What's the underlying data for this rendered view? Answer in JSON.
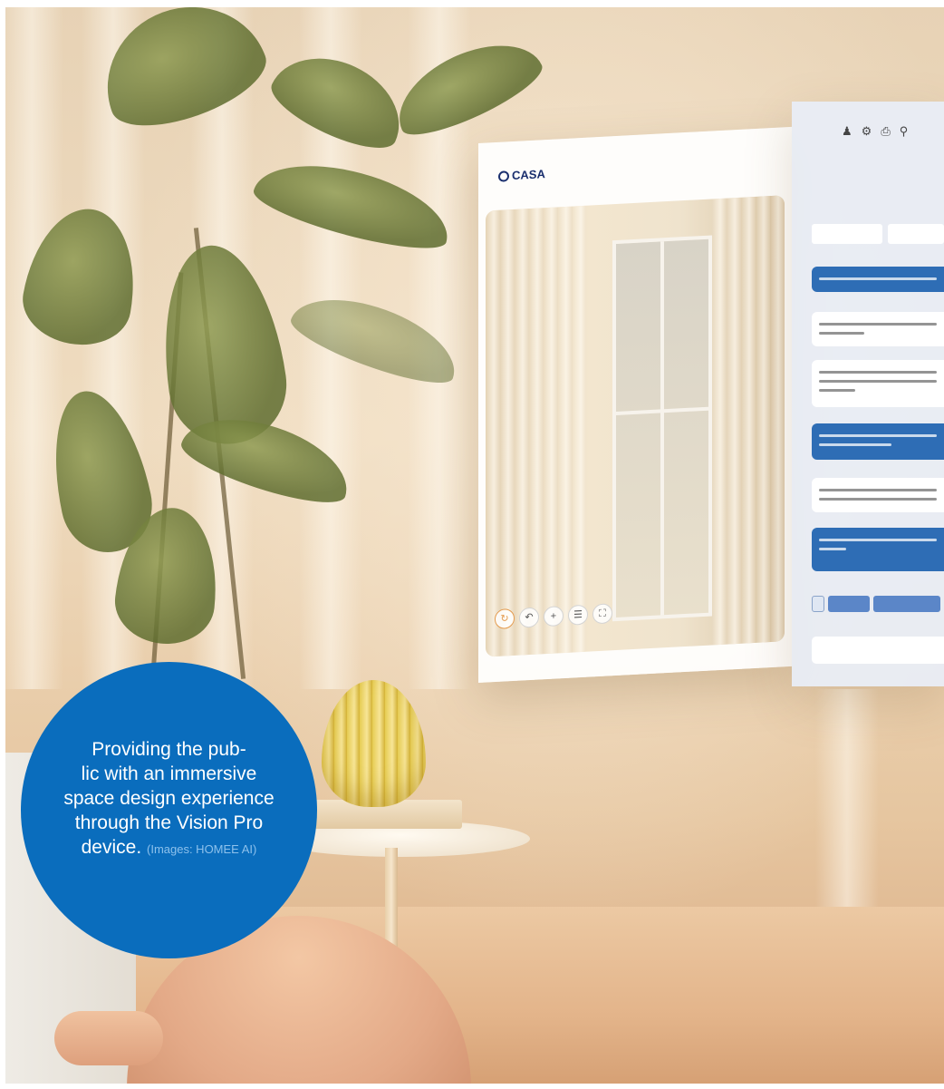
{
  "caption": {
    "line1": "Providing the pub-",
    "line2": "lic with an immersive",
    "line3": "space design experience",
    "line4": "through the Vision Pro",
    "line5": "device.",
    "credit": "(Images: HOMEE AI)",
    "background_color": "#0a6dbd"
  },
  "app_window": {
    "logo": "CASA",
    "toolbar_icons": [
      "rotate-icon",
      "undo-icon",
      "add-icon",
      "layers-icon",
      "expand-icon"
    ],
    "panel_icons": [
      "person-icon",
      "settings-icon",
      "share-icon",
      "location-icon"
    ],
    "accent_color": "#2e6db5"
  }
}
